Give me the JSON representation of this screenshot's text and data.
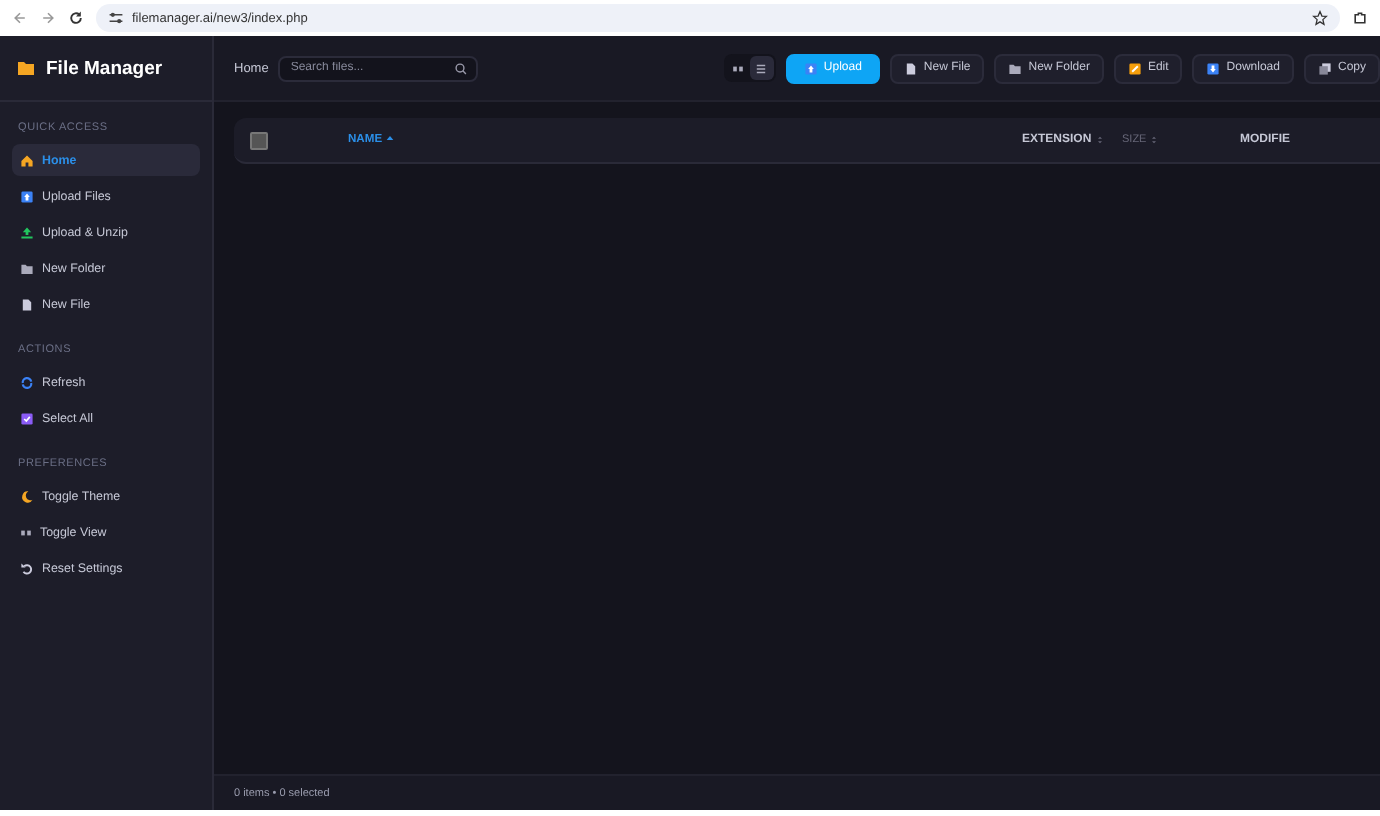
{
  "browser": {
    "url": "filemanager.ai/new3/index.php"
  },
  "app": {
    "title": "File Manager"
  },
  "sidebar": {
    "sections": [
      {
        "heading": "QUICK ACCESS",
        "items": [
          {
            "label": "Home",
            "selected": true
          },
          {
            "label": "Upload Files",
            "selected": false
          },
          {
            "label": "Upload & Unzip",
            "selected": false
          },
          {
            "label": "New Folder",
            "selected": false
          },
          {
            "label": "New File",
            "selected": false
          }
        ]
      },
      {
        "heading": "ACTIONS",
        "items": [
          {
            "label": "Refresh",
            "selected": false
          },
          {
            "label": "Select All",
            "selected": false
          }
        ]
      },
      {
        "heading": "PREFERENCES",
        "items": [
          {
            "label": "Toggle Theme",
            "selected": false
          },
          {
            "label": "Toggle View",
            "selected": false
          },
          {
            "label": "Reset Settings",
            "selected": false
          }
        ]
      }
    ]
  },
  "header": {
    "breadcrumb": "Home",
    "search": {
      "placeholder": "Search files..."
    },
    "view_toggle": [
      {
        "kind": "grid",
        "selected": false
      },
      {
        "kind": "list",
        "selected": true
      }
    ],
    "buttons": [
      {
        "label": "Upload",
        "kind": "primary"
      },
      {
        "label": "New File",
        "kind": "plain"
      },
      {
        "label": "New Folder",
        "kind": "plain"
      },
      {
        "label": "Edit",
        "kind": "plain"
      },
      {
        "label": "Download",
        "kind": "plain"
      },
      {
        "label": "Copy",
        "kind": "plain"
      }
    ]
  },
  "table": {
    "select_all": {
      "checked": false
    },
    "columns": [
      {
        "label": "NAME",
        "sorted": true
      },
      {
        "label": "EXTENSION",
        "sorted": false
      },
      {
        "label": "SIZE",
        "sorted": false
      },
      {
        "label": "MODIFIE",
        "sorted": false
      }
    ]
  },
  "status_bar": "0 items • 0 selected"
}
